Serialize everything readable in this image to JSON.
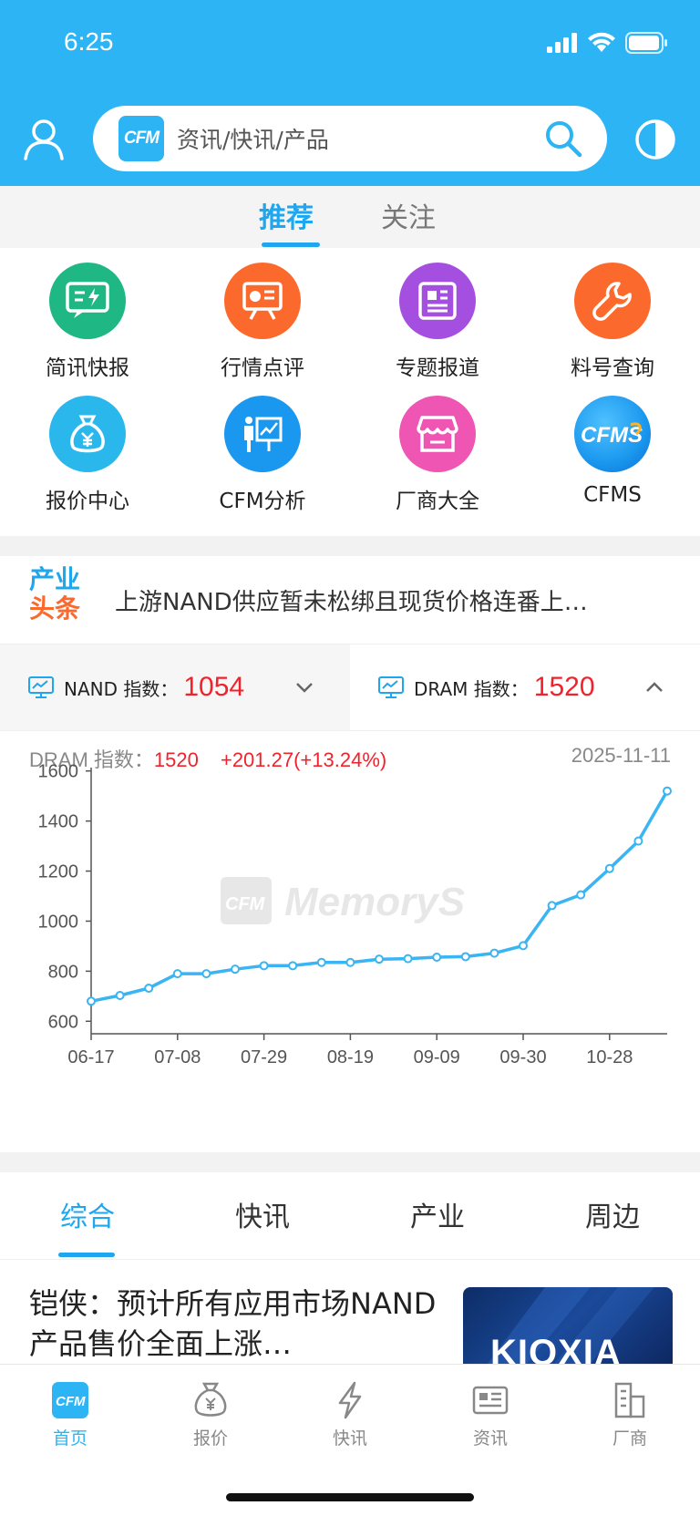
{
  "status": {
    "time": "6:25"
  },
  "search": {
    "logo": "CFM",
    "placeholder": "资讯/快讯/产品"
  },
  "main_tabs": [
    {
      "label": "推荐"
    },
    {
      "label": "关注"
    }
  ],
  "shortcuts": [
    {
      "label": "简讯快报",
      "color": "#1fb783",
      "icon": "news-flash-icon"
    },
    {
      "label": "行情点评",
      "color": "#fb6a2c",
      "icon": "market-review-icon"
    },
    {
      "label": "专题报道",
      "color": "#a54fe0",
      "icon": "report-icon"
    },
    {
      "label": "料号查询",
      "color": "#fb6a2c",
      "icon": "wrench-icon"
    },
    {
      "label": "报价中心",
      "color": "#29b7ec",
      "icon": "money-bag-icon"
    },
    {
      "label": "CFM分析",
      "color": "#1a97ee",
      "icon": "analysis-icon"
    },
    {
      "label": "厂商大全",
      "color": "#ef55b3",
      "icon": "store-icon"
    },
    {
      "label": "CFMS",
      "color": "#1a97ee",
      "icon": "cfms-logo-icon"
    }
  ],
  "headline": {
    "logo_line1": "产业",
    "logo_line2": "头条",
    "text": "上游NAND供应暂未松绑且现货价格连番上…"
  },
  "indices": [
    {
      "name": "NAND 指数：",
      "value": "1054",
      "state": "collapsed"
    },
    {
      "name": "DRAM 指数：",
      "value": "1520",
      "state": "expanded"
    }
  ],
  "chart_summary": {
    "label": "DRAM 指数：",
    "value": "1520",
    "change": "+201.27(+13.24%)",
    "date": "2025-11-11"
  },
  "watermark": {
    "logo": "CFM",
    "text": "MemoryS"
  },
  "chart_data": {
    "type": "line",
    "series": [
      {
        "values": [
          680,
          703,
          732,
          790,
          790,
          808,
          822,
          822,
          835,
          835,
          848,
          850,
          856,
          858,
          872,
          902,
          1062,
          1105,
          1210,
          1320,
          1520
        ]
      }
    ],
    "xticks": [
      "06-17",
      "07-08",
      "07-29",
      "08-19",
      "09-09",
      "09-30",
      "10-28"
    ],
    "yticks": [
      600,
      800,
      1000,
      1200,
      1400,
      1600
    ],
    "ylim": [
      550,
      1650
    ],
    "color": "#3ab4f2",
    "grid": false
  },
  "news_tabs": [
    {
      "label": "综合"
    },
    {
      "label": "快讯"
    },
    {
      "label": "产业"
    },
    {
      "label": "周边"
    }
  ],
  "news": {
    "title": "铠侠：预计所有应用市场NAND产品售价全面上涨…",
    "thumb_text": "KIOXIA"
  },
  "bottom_nav": [
    {
      "label": "首页",
      "icon": "home-cfm-icon",
      "active": true
    },
    {
      "label": "报价",
      "icon": "price-bag-icon",
      "active": false
    },
    {
      "label": "快讯",
      "icon": "lightning-icon",
      "active": false
    },
    {
      "label": "资讯",
      "icon": "newspaper-icon",
      "active": false
    },
    {
      "label": "厂商",
      "icon": "building-icon",
      "active": false
    }
  ],
  "colors": {
    "brand": "#2cb4f4",
    "accent": "#1ea6ee",
    "up": "#f2222c"
  }
}
